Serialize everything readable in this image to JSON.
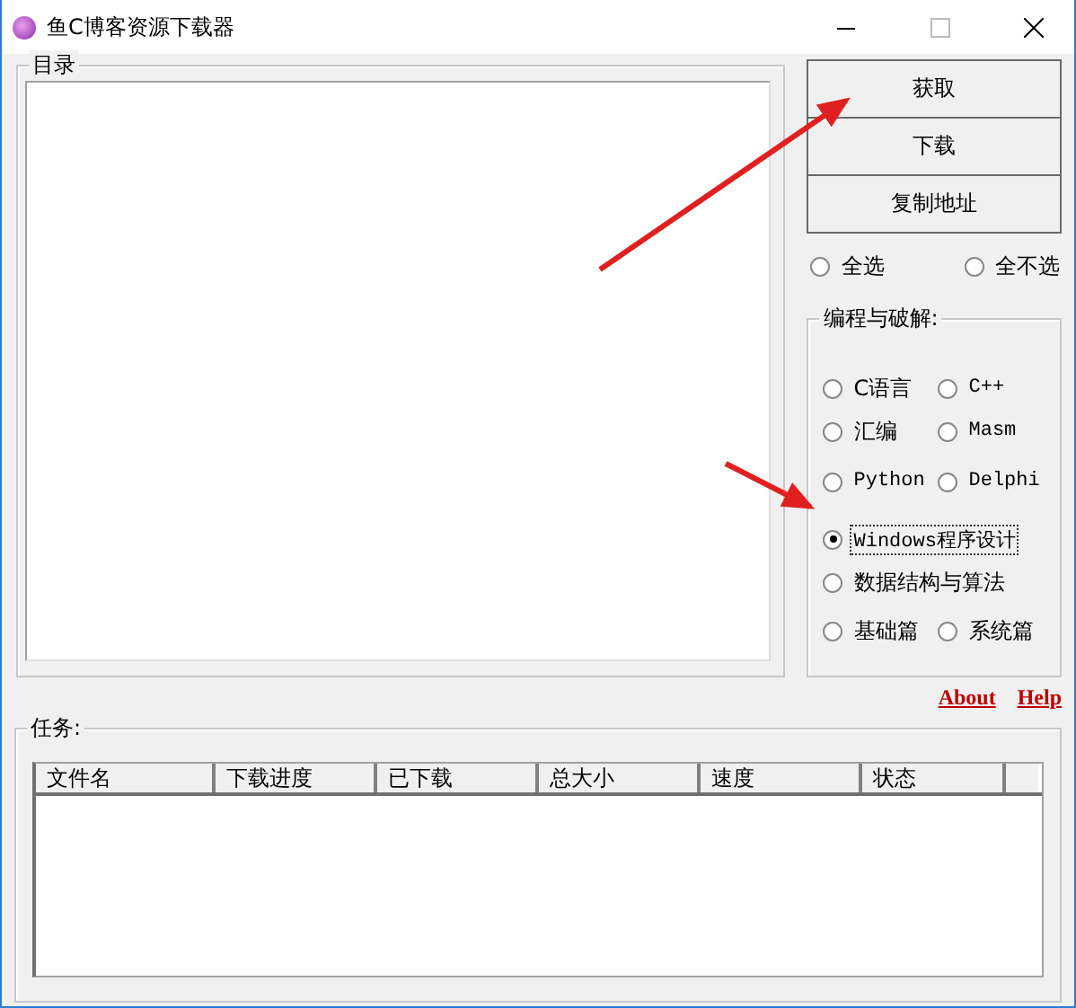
{
  "window": {
    "title": "鱼C博客资源下载器"
  },
  "directory_group": {
    "title": "目录"
  },
  "buttons": [
    "获取",
    "下载",
    "复制地址"
  ],
  "select_options": [
    {
      "label": "全选",
      "selected": false
    },
    {
      "label": "全不选",
      "selected": false
    }
  ],
  "category_group": {
    "title": "编程与破解:",
    "rows": [
      [
        {
          "label": "C语言",
          "selected": false
        },
        {
          "label": "C++",
          "selected": false
        }
      ],
      [
        {
          "label": "汇编",
          "selected": false
        },
        {
          "label": "Masm",
          "selected": false
        }
      ],
      [
        {
          "label": "Python",
          "selected": false
        },
        {
          "label": "Delphi",
          "selected": false
        }
      ],
      [
        {
          "label": "Windows程序设计",
          "selected": true
        }
      ],
      [
        {
          "label": "数据结构与算法",
          "selected": false
        }
      ],
      [
        {
          "label": "基础篇",
          "selected": false
        },
        {
          "label": "系统篇",
          "selected": false
        }
      ]
    ]
  },
  "links": [
    "About",
    "Help"
  ],
  "task_group": {
    "title": "任务:",
    "columns": [
      "文件名",
      "下载进度",
      "已下载",
      "总大小",
      "速度",
      "状态"
    ]
  }
}
